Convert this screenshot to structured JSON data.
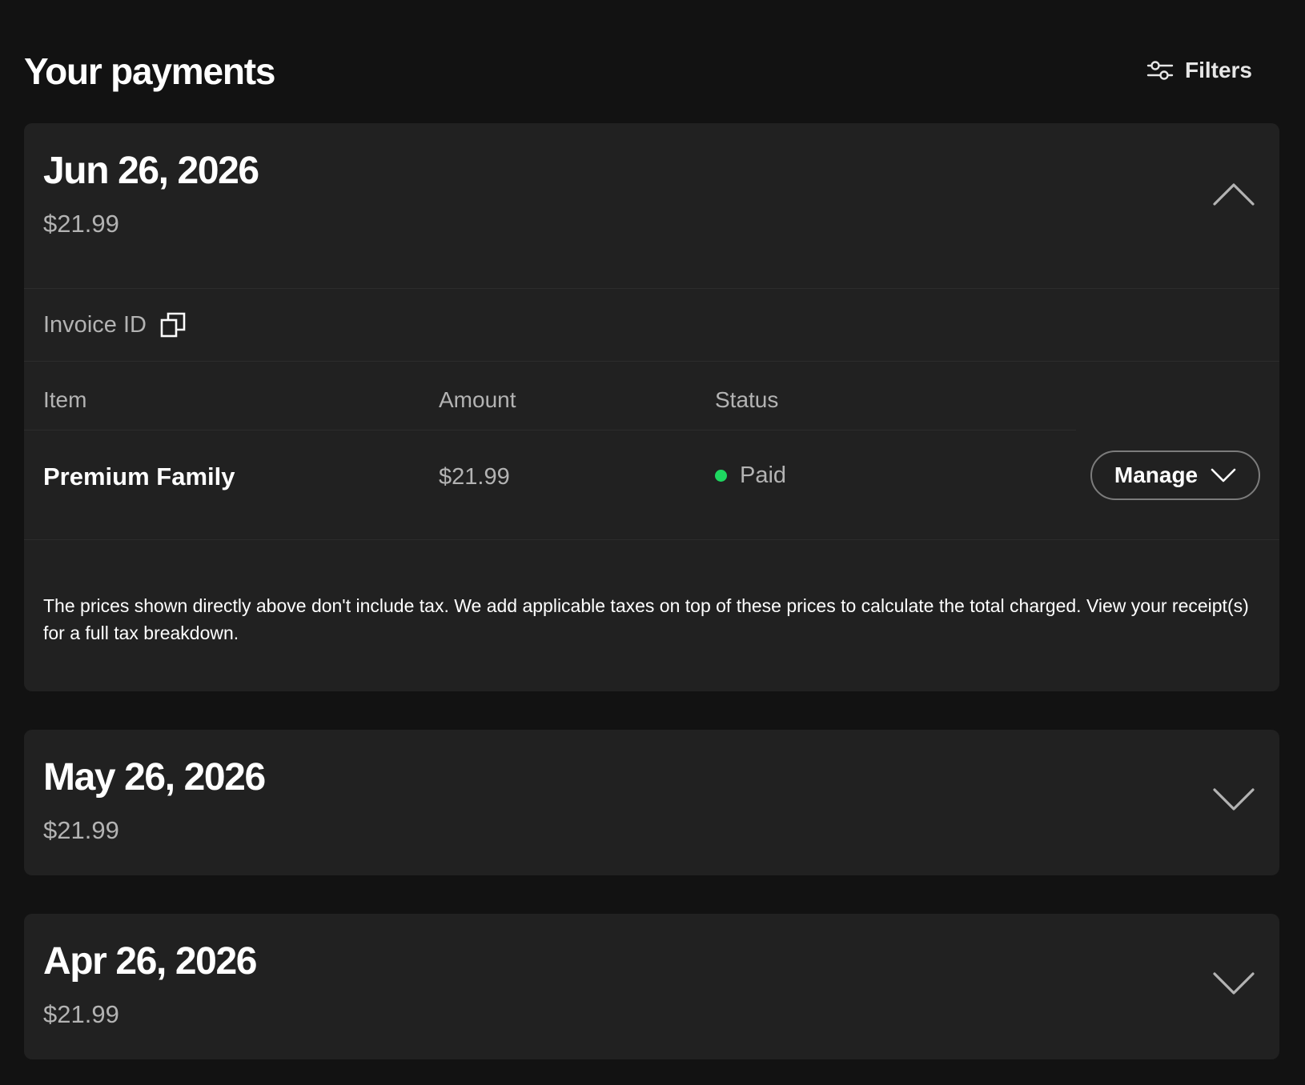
{
  "page": {
    "title": "Your payments",
    "filters_label": "Filters"
  },
  "payments": [
    {
      "date": "Jun 26, 2026",
      "amount": "$21.99",
      "expanded": true,
      "invoice_label": "Invoice ID",
      "table": {
        "headers": [
          "Item",
          "Amount",
          "Status"
        ],
        "rows": [
          {
            "item": "Premium Family",
            "amount": "$21.99",
            "status": "Paid",
            "action": "Manage"
          }
        ]
      },
      "tax_note": "The prices shown directly above don't include tax. We add applicable taxes on top of these prices to calculate the total charged. View your receipt(s) for a full tax breakdown."
    },
    {
      "date": "May 26, 2026",
      "amount": "$21.99",
      "expanded": false
    },
    {
      "date": "Apr 26, 2026",
      "amount": "$21.99",
      "expanded": false
    }
  ],
  "icons": {
    "filters": "sliders-icon",
    "collapse": "chevron-up-icon",
    "expand": "chevron-down-icon",
    "copy": "copy-icon",
    "manage": "chevron-down-icon"
  },
  "colors": {
    "background": "#121212",
    "card": "#212121",
    "status_paid": "#1ed760",
    "text_secondary": "#b3b3b3"
  }
}
